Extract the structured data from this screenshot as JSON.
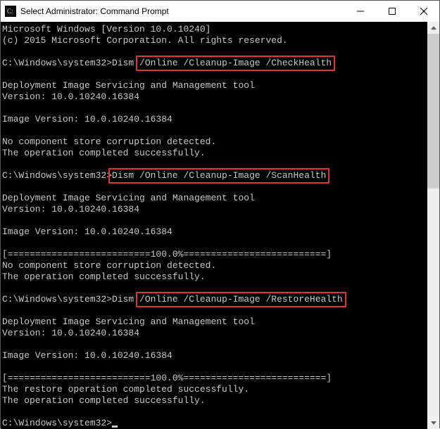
{
  "window": {
    "title": "Select Administrator: Command Prompt"
  },
  "term": {
    "header1": "Microsoft Windows [Version 10.0.10240]",
    "header2": "(c) 2015 Microsoft Corporation. All rights reserved.",
    "prompt": "C:\\Windows\\system32>",
    "dism_word": "Dism ",
    "cmd1_hl": "/Online /Cleanup-Image /CheckHealth",
    "cmd2_hl": "Dism /Online /Cleanup-Image /ScanHealth",
    "cmd3_hl": "/Online /Cleanup-Image /RestoreHealth",
    "tool_line": "Deployment Image Servicing and Management tool",
    "version_line": "Version: 10.0.10240.16384",
    "image_version": "Image Version: 10.0.10240.16384",
    "no_corruption": "No component store corruption detected.",
    "op_success": "The operation completed successfully.",
    "progress": "[==========================100.0%==========================]",
    "restore_success": "The restore operation completed successfully."
  }
}
